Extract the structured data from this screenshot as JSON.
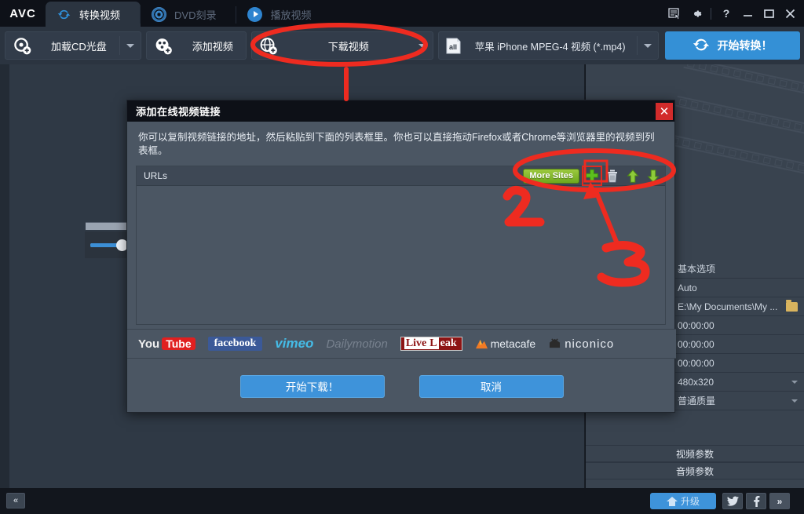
{
  "app": {
    "logo": "AVC",
    "tabs": [
      {
        "label": "转换视频",
        "icon": "sync-icon",
        "active": true
      },
      {
        "label": "DVD刻录",
        "icon": "disc-icon",
        "active": false
      },
      {
        "label": "播放视频",
        "icon": "play-icon",
        "active": false
      }
    ],
    "window_controls": [
      {
        "name": "list-select-icon",
        "glyph": "▤"
      },
      {
        "name": "gear-icon",
        "glyph": "✿"
      },
      {
        "name": "help-icon",
        "glyph": "?"
      },
      {
        "name": "minimize-icon",
        "glyph": "—"
      },
      {
        "name": "maximize-icon",
        "glyph": "▢"
      },
      {
        "name": "close-icon",
        "glyph": "✕"
      }
    ]
  },
  "toolbar": {
    "load_cd": "加载CD光盘",
    "add_video": "添加视频",
    "download_video": "下载视频",
    "profile": "苹果 iPhone MPEG-4 视频 (*.mp4)",
    "convert": "开始转换！",
    "profile_icon": "all-formats-icon"
  },
  "right_panel": {
    "options_title": "基本选项",
    "rows": [
      {
        "name": "deinterlace-value",
        "value": "Auto"
      },
      {
        "name": "output-folder",
        "value": "E:\\My Documents\\My ..."
      },
      {
        "name": "start-time",
        "value": "00:00:00"
      },
      {
        "name": "end-time",
        "value": "00:00:00"
      },
      {
        "name": "duration",
        "value": "00:00:00"
      },
      {
        "name": "resolution",
        "value": "480x320"
      },
      {
        "name": "quality",
        "value": "普通质量"
      }
    ],
    "video_params": "视频参数",
    "audio_params": "音频参数",
    "player_icons": [
      "crop-icon",
      "scissors-icon",
      "effects-icon"
    ]
  },
  "dialog": {
    "title": "添加在线视频链接",
    "close": "✕",
    "description": "你可以复制视频链接的地址，然后粘贴到下面的列表框里。你也可以直接拖动Firefox或者Chrome等浏览器里的视频到列表框。",
    "list_header": "URLs",
    "more_sites": "More Sites",
    "tool_icons": [
      {
        "name": "add-url-icon",
        "glyph": "✛"
      },
      {
        "name": "delete-url-icon",
        "glyph": "🗑"
      },
      {
        "name": "move-up-icon",
        "glyph": "⬆"
      },
      {
        "name": "move-down-icon",
        "glyph": "⬇"
      }
    ],
    "sites": [
      {
        "name": "youtube-logo",
        "part1": "You",
        "part2": "Tube"
      },
      {
        "name": "facebook-logo",
        "text": "facebook"
      },
      {
        "name": "vimeo-logo",
        "text": "vimeo"
      },
      {
        "name": "dailymotion-logo",
        "text": "Dailymotion"
      },
      {
        "name": "liveleak-logo",
        "part1": "Live",
        "part2": "L",
        "part3": "eak"
      },
      {
        "name": "metacafe-logo",
        "text": "metacafe"
      },
      {
        "name": "niconico-logo",
        "text": "niconico"
      }
    ],
    "start_download": "开始下载！",
    "cancel": "取消"
  },
  "footer": {
    "collapse": "«",
    "upgrade": "升级",
    "twitter": "twitter-icon",
    "facebook": "facebook-icon",
    "more": "»"
  },
  "annotations": {
    "marker_2": "2",
    "marker_3": "3",
    "color": "#ee2b20"
  }
}
